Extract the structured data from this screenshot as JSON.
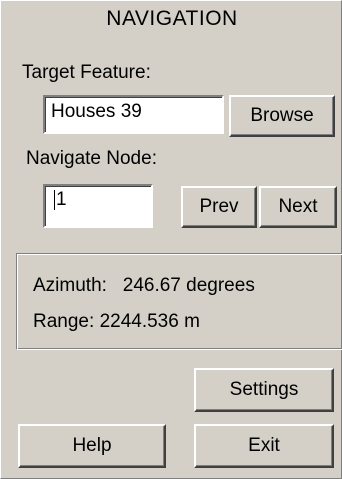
{
  "header": {
    "title": "NAVIGATION"
  },
  "target": {
    "label": "Target Feature:",
    "value": "Houses 39",
    "browse_label": "Browse"
  },
  "node": {
    "label": "Navigate Node:",
    "value": "1",
    "prev_label": "Prev",
    "next_label": "Next"
  },
  "info": {
    "azimuth_label": "Azimuth:",
    "azimuth_value": "246.67 degrees",
    "range_label": "Range:",
    "range_value": "2244.536 m"
  },
  "footer": {
    "settings_label": "Settings",
    "help_label": "Help",
    "exit_label": "Exit"
  }
}
